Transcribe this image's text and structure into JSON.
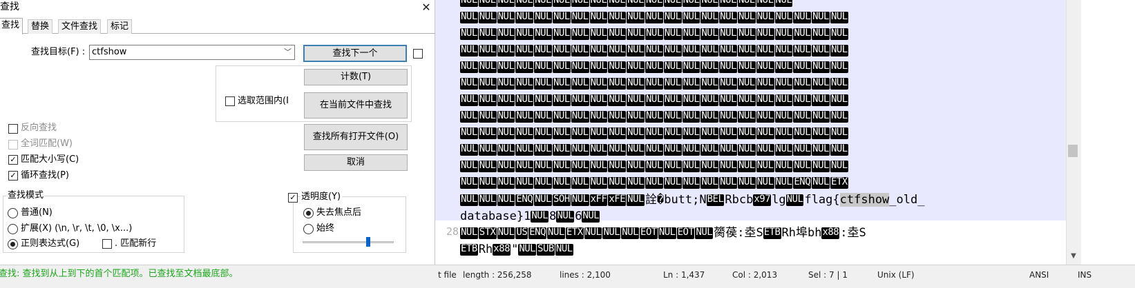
{
  "dialog": {
    "title": "查找",
    "close_glyph": "✕",
    "tabs": [
      "查找",
      "替换",
      "文件查找",
      "标记"
    ],
    "find_label": "查找目标(F) :",
    "find_value": "ctfshow",
    "buttons": {
      "find_next": "查找下一个",
      "count": "计数(T)",
      "find_in_current": "在当前文件中查找",
      "find_all_open": "查找所有打开文件(O)",
      "cancel": "取消"
    },
    "in_selection": "选取范围内(I",
    "options": {
      "backward": {
        "label": "反向查找",
        "checked": false,
        "enabled": true
      },
      "whole_word": {
        "label": "全词匹配(W)",
        "checked": false,
        "enabled": false
      },
      "match_case": {
        "label": "匹配大小写(C)",
        "checked": true,
        "enabled": true
      },
      "wrap_around": {
        "label": "循环查找(P)",
        "checked": true,
        "enabled": true
      }
    },
    "search_mode": {
      "title": "查找模式",
      "normal": "普通(N)",
      "extended": "扩展(X) (\\n, \\r, \\t, \\0, \\x...)",
      "regex": "正则表达式(G)",
      "dot_newline": ". 匹配新行",
      "selected": "regex"
    },
    "transparency": {
      "title": "透明度(Y)",
      "checked": true,
      "on_lose_focus": "失去焦点后",
      "always": "始终",
      "selected": "on_lose_focus",
      "level": 0.72
    },
    "status_message": "查找: 查找到从上到下的首个匹配项。已查找至文档最底部。"
  },
  "editor": {
    "line_number": "28",
    "lines": [
      [
        {
          "t": "tok",
          "v": "NUL",
          "n": 18
        }
      ],
      [
        {
          "t": "tok",
          "v": "NUL",
          "n": 21
        }
      ],
      [
        {
          "t": "tok",
          "v": "NUL",
          "n": 21
        }
      ],
      [
        {
          "t": "tok",
          "v": "NUL",
          "n": 21
        }
      ],
      [
        {
          "t": "tok",
          "v": "NUL",
          "n": 21
        }
      ],
      [
        {
          "t": "tok",
          "v": "NUL",
          "n": 21
        }
      ],
      [
        {
          "t": "tok",
          "v": "NUL",
          "n": 21
        }
      ],
      [
        {
          "t": "tok",
          "v": "NUL",
          "n": 21
        }
      ],
      [
        {
          "t": "tok",
          "v": "NUL",
          "n": 21
        }
      ],
      [
        {
          "t": "tok",
          "v": "NUL",
          "n": 21
        }
      ],
      [
        {
          "t": "tok",
          "v": "NUL",
          "n": 21
        }
      ],
      [
        {
          "t": "tok",
          "v": "NUL",
          "n": 18
        },
        {
          "t": "tok",
          "v": "ENQ"
        },
        {
          "t": "tok",
          "v": "NUL"
        },
        {
          "t": "tok",
          "v": "ETX"
        }
      ],
      [
        {
          "t": "tok",
          "v": "NUL",
          "n": 3
        },
        {
          "t": "tok",
          "v": "ENQ"
        },
        {
          "t": "tok",
          "v": "NUL"
        },
        {
          "t": "tok",
          "v": "SOH"
        },
        {
          "t": "tok",
          "v": "NUL"
        },
        {
          "t": "tok",
          "v": "xFF"
        },
        {
          "t": "tok",
          "v": "xFE"
        },
        {
          "t": "tok",
          "v": "NUL"
        },
        {
          "t": "txt",
          "v": "詮�butt;N"
        },
        {
          "t": "tok",
          "v": "BEL"
        },
        {
          "t": "txt",
          "v": "Rbcb"
        },
        {
          "t": "tok",
          "v": "x97"
        },
        {
          "t": "txt",
          "v": "lg"
        },
        {
          "t": "tok",
          "v": "NUL"
        },
        {
          "t": "txt",
          "v": "flag{"
        },
        {
          "t": "hl",
          "v": "ctfshow"
        },
        {
          "t": "txt",
          "v": "_old_"
        }
      ],
      [
        {
          "t": "txt",
          "v": "database}1"
        },
        {
          "t": "tok",
          "v": "NUL"
        },
        {
          "t": "txt",
          "v": "8"
        },
        {
          "t": "tok",
          "v": "NUL"
        },
        {
          "t": "txt",
          "v": "6"
        },
        {
          "t": "tok",
          "v": "NUL"
        }
      ],
      [
        {
          "t": "tok",
          "v": "NUL"
        },
        {
          "t": "tok",
          "v": "STX"
        },
        {
          "t": "tok",
          "v": "NUL"
        },
        {
          "t": "tok",
          "v": "US"
        },
        {
          "t": "tok",
          "v": "ENQ"
        },
        {
          "t": "tok",
          "v": "NUL"
        },
        {
          "t": "tok",
          "v": "ETX"
        },
        {
          "t": "tok",
          "v": "NUL",
          "n": 3
        },
        {
          "t": "tok",
          "v": "EOT"
        },
        {
          "t": "tok",
          "v": "NUL"
        },
        {
          "t": "tok",
          "v": "EOT"
        },
        {
          "t": "tok",
          "v": "NUL"
        },
        {
          "t": "txt",
          "v": "膐葔:坴S"
        },
        {
          "t": "tok",
          "v": "ETB"
        },
        {
          "t": "txt",
          "v": "Rh埠bh"
        },
        {
          "t": "tok",
          "v": "x88"
        },
        {
          "t": "txt",
          "v": ":坴S"
        }
      ],
      [
        {
          "t": "tok",
          "v": "ETB"
        },
        {
          "t": "txt",
          "v": "Rh"
        },
        {
          "t": "tok",
          "v": "x88"
        },
        {
          "t": "txt",
          "v": "\""
        },
        {
          "t": "tok",
          "v": "NUL"
        },
        {
          "t": "tok",
          "v": "SUB"
        },
        {
          "t": "tok",
          "v": "NUL"
        }
      ]
    ],
    "status_bar": [
      "t file",
      "length : 256,258",
      "lines : 2,100",
      "Ln : 1,437",
      "Col : 2,013",
      "Sel : 7 | 1",
      "Unix (LF)",
      "ANSI",
      "INS"
    ]
  }
}
